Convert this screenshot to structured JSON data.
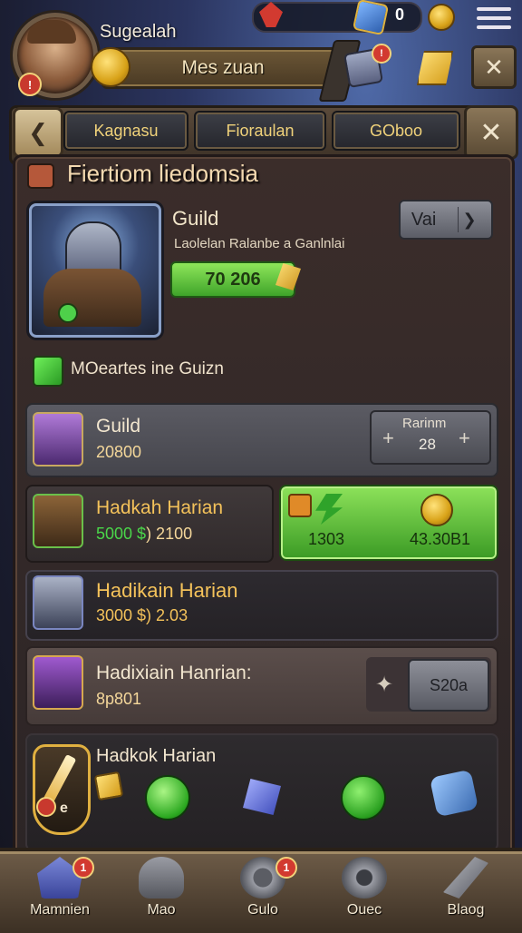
{
  "header": {
    "player_name": "Sugealah",
    "banner_label": "Mes zuan",
    "resource_value": "0",
    "avatar_badge": "!",
    "shield_badge": "!",
    "close_label": "✕"
  },
  "tabs": {
    "back_label": "❮",
    "items": [
      {
        "label": "Kagnasu"
      },
      {
        "label": "Fioraulan"
      },
      {
        "label": "GOboo"
      }
    ],
    "close_label": "✕"
  },
  "panel": {
    "title": "Fiertiom liedomsia",
    "guild_title": "Guild",
    "guild_subtitle": "Laolelan Ralanbe a Ganlnlai",
    "guild_value": "70 206",
    "vai_label": "Vai",
    "vai_arrow": "❯",
    "moderates_label": "MOeartes ine Guizn"
  },
  "rows": [
    {
      "name": "Guild",
      "value": "20800",
      "stepper_label": "Rarinm",
      "stepper_value": "28",
      "minus": "+",
      "plus": "+"
    },
    {
      "name": "Hadkah Harian",
      "value_green": "5000 $",
      "value_rest": ") 2100",
      "left_value": "1303",
      "right_value": "43.30B1"
    },
    {
      "name": "Hadikain Harian",
      "value": "3000 $) 2.03"
    },
    {
      "name": "Hadixiain Hanrian:",
      "value": "8p801",
      "buy_label": "S20a",
      "spark": "✦"
    },
    {
      "name": "Hadkok Harian",
      "sword_label": "e"
    }
  ],
  "bottom_nav": [
    {
      "label": "Mamnien",
      "icon": "home-icon",
      "badge": "1"
    },
    {
      "label": "Mao",
      "icon": "map-icon",
      "badge": ""
    },
    {
      "label": "Gulo",
      "icon": "guild-icon",
      "badge": "1"
    },
    {
      "label": "Ouec",
      "icon": "quest-icon",
      "badge": ""
    },
    {
      "label": "Blaog",
      "icon": "blog-icon",
      "badge": ""
    }
  ],
  "colors": {
    "accent_gold": "#f4c25a",
    "accent_green": "#4ad64a",
    "badge_red": "#d23a30"
  }
}
